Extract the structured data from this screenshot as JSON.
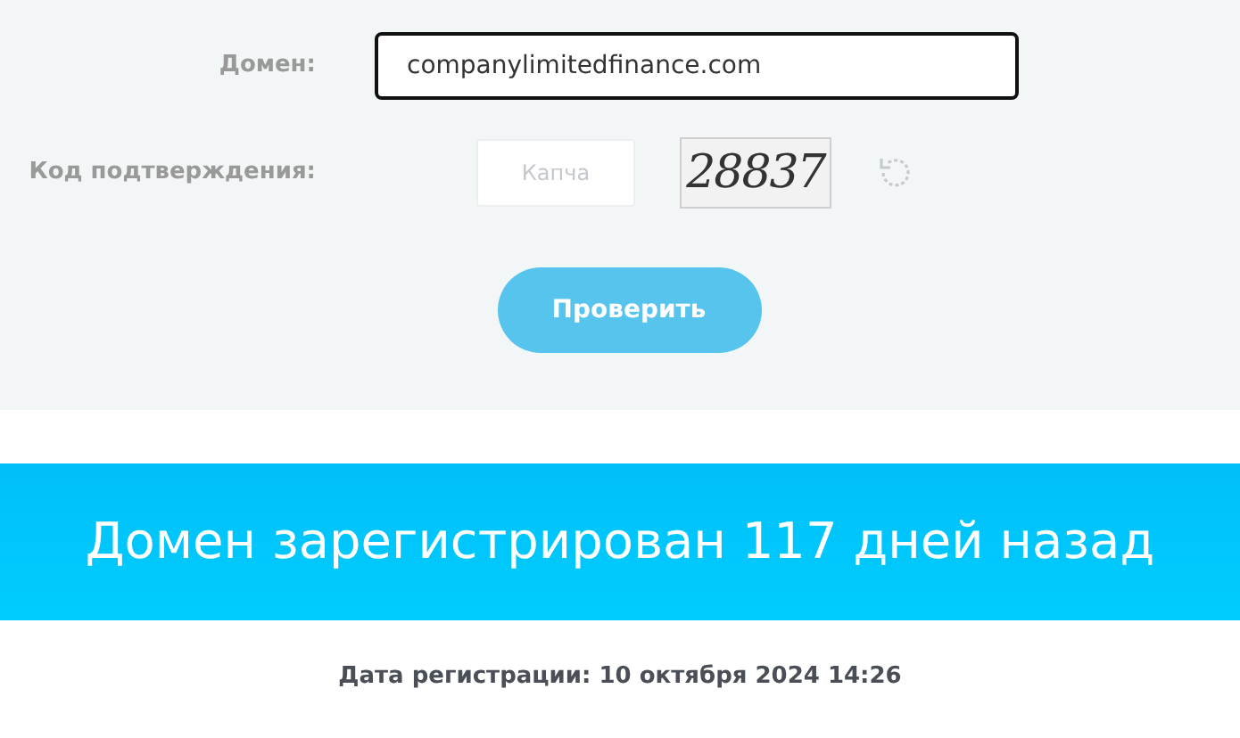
{
  "form": {
    "domain_label": "Домен:",
    "domain_value": "companylimitedfinance.com",
    "domain_focused": true,
    "captcha_label": "Код подтверждения:",
    "captcha_placeholder": "Капча",
    "captcha_code": "28837",
    "submit_button": "Проверить"
  },
  "result": {
    "headline": "Домен зарегистрирован 117 дней назад",
    "registration_date": "Дата регистрации: 10 октября 2024 14:26"
  }
}
